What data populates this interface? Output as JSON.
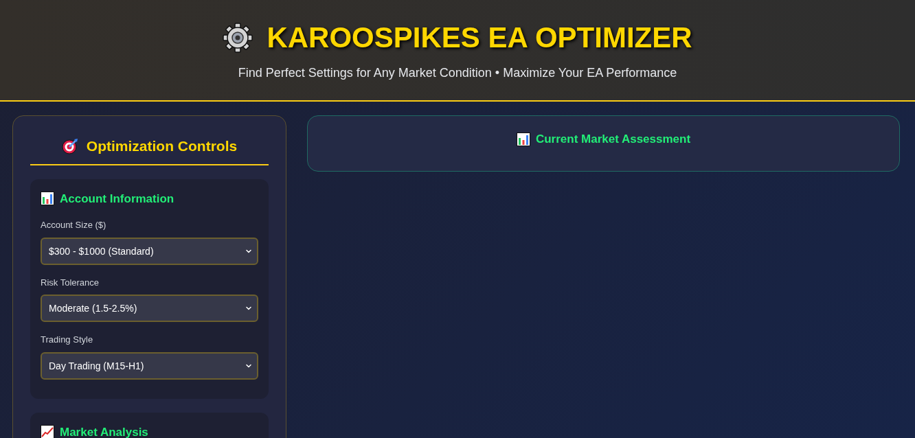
{
  "header": {
    "title": "KAROOSPIKES EA OPTIMIZER",
    "subtitle": "Find Perfect Settings for Any Market Condition • Maximize Your EA Performance"
  },
  "controls": {
    "title": "Optimization Controls",
    "sections": [
      {
        "title": "Account Information",
        "fields": [
          {
            "label": "Account Size ($)",
            "value": "$300 - $1000 (Standard)"
          },
          {
            "label": "Risk Tolerance",
            "value": "Moderate (1.5-2.5%)"
          },
          {
            "label": "Trading Style",
            "value": "Day Trading (M15-H1)"
          }
        ]
      },
      {
        "title": "Market Analysis"
      }
    ]
  },
  "assessment": {
    "title": "Current Market Assessment"
  }
}
